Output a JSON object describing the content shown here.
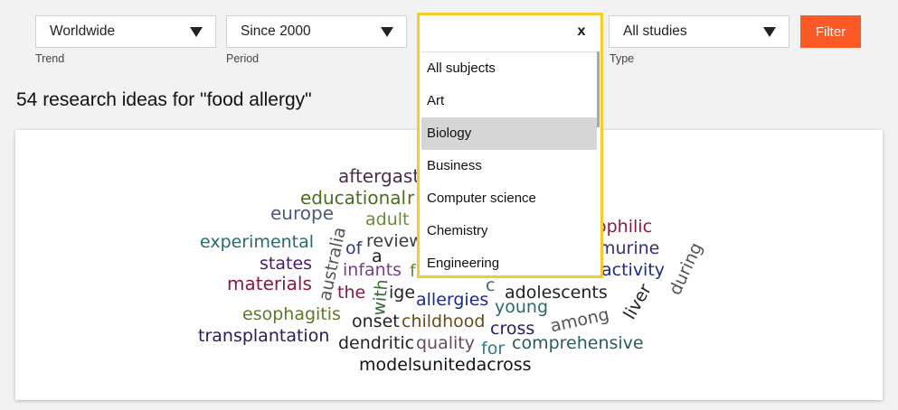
{
  "filters": {
    "trend": {
      "value": "Worldwide",
      "label": "Trend"
    },
    "period": {
      "value": "Since 2000",
      "label": "Period"
    },
    "subject": {
      "search_value": "",
      "clear_label": "x"
    },
    "type": {
      "value": "All studies",
      "label": "Type"
    },
    "filter_button": "Filter"
  },
  "dropdown": {
    "options": [
      "All subjects",
      "Art",
      "Biology",
      "Business",
      "Computer science",
      "Chemistry",
      "Engineering"
    ],
    "highlighted": "Biology"
  },
  "heading": "54 research ideas for \"food allergy\"",
  "word_cloud": {
    "words": [
      {
        "text": "aftergast",
        "color": "#4a2f4a"
      },
      {
        "text": "educational",
        "color": "#4a6e1a"
      },
      {
        "text": "r",
        "color": "#4a6e1a"
      },
      {
        "text": "europe",
        "color": "#4a5a7a"
      },
      {
        "text": "adult",
        "color": "#6a8a3a"
      },
      {
        "text": "experimental",
        "color": "#2a6a6a"
      },
      {
        "text": "of",
        "color": "#2a3a7a"
      },
      {
        "text": "review",
        "color": "#3a3a3a"
      },
      {
        "text": "a",
        "color": "#222222"
      },
      {
        "text": "states",
        "color": "#4a1a6a"
      },
      {
        "text": "infants",
        "color": "#7a3a8a"
      },
      {
        "text": "materials",
        "color": "#8a1a3a"
      },
      {
        "text": "the",
        "color": "#8a1a3a"
      },
      {
        "text": "ige",
        "color": "#222222"
      },
      {
        "text": "allergies",
        "color": "#1a2a8a"
      },
      {
        "text": "adolescents",
        "color": "#222222"
      },
      {
        "text": "esophagitis",
        "color": "#5a7a2a"
      },
      {
        "text": "young",
        "color": "#2a6a6a"
      },
      {
        "text": "onset",
        "color": "#222222"
      },
      {
        "text": "childhood",
        "color": "#6a4a1a"
      },
      {
        "text": "cross",
        "color": "#2a1a6a"
      },
      {
        "text": "among",
        "color": "#555555"
      },
      {
        "text": "transplantation",
        "color": "#2a1a5a"
      },
      {
        "text": "dendritic",
        "color": "#222222"
      },
      {
        "text": "quality",
        "color": "#6a4a5a"
      },
      {
        "text": "for",
        "color": "#3a7a7a"
      },
      {
        "text": "comprehensive",
        "color": "#2a5a5a"
      },
      {
        "text": "modelsunitedacross",
        "color": "#111111"
      },
      {
        "text": "ophilic",
        "color": "#8a1a3a"
      },
      {
        "text": "murine",
        "color": "#3a2a7a"
      },
      {
        "text": "activity",
        "color": "#1a2a8a"
      },
      {
        "text": "australia",
        "color": "#555555"
      },
      {
        "text": "with",
        "color": "#3a6a3a"
      },
      {
        "text": "liver",
        "color": "#222222"
      },
      {
        "text": "during",
        "color": "#555555"
      },
      {
        "text": "c",
        "color": "#3a6a6a"
      },
      {
        "text": "f",
        "color": "#6a8a3a"
      }
    ]
  }
}
